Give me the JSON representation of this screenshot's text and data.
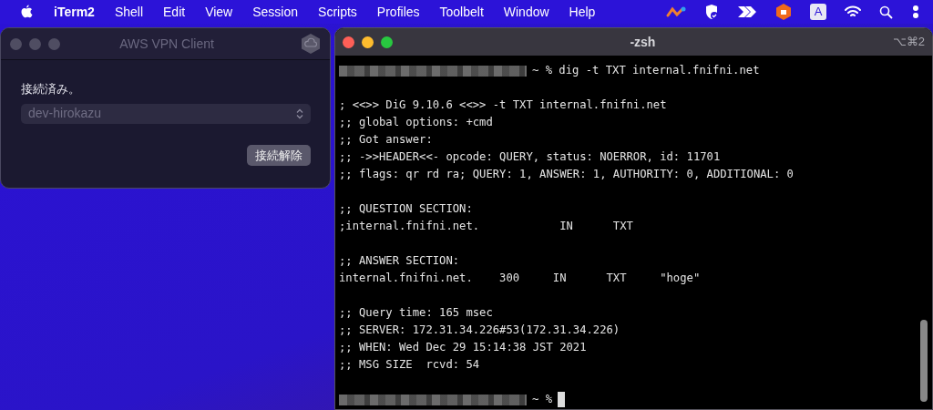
{
  "menubar": {
    "app": "iTerm2",
    "items": [
      "Shell",
      "Edit",
      "View",
      "Session",
      "Scripts",
      "Profiles",
      "Toolbelt",
      "Window",
      "Help"
    ],
    "input_source": "A"
  },
  "vpn_window": {
    "title": "AWS VPN Client",
    "status": "接続済み。",
    "profile": "dev-hirokazu",
    "button": "接続解除"
  },
  "terminal": {
    "title": "-zsh",
    "shortcut": "⌥⌘2",
    "lines": [
      {
        "kind": "prompt",
        "text": "~ % dig -t TXT internal.fnifni.net",
        "cursor": false
      },
      {
        "kind": "blank"
      },
      {
        "kind": "output",
        "text": "; <<>> DiG 9.10.6 <<>> -t TXT internal.fnifni.net"
      },
      {
        "kind": "output",
        "text": ";; global options: +cmd"
      },
      {
        "kind": "output",
        "text": ";; Got answer:"
      },
      {
        "kind": "output",
        "text": ";; ->>HEADER<<- opcode: QUERY, status: NOERROR, id: 11701"
      },
      {
        "kind": "output",
        "text": ";; flags: qr rd ra; QUERY: 1, ANSWER: 1, AUTHORITY: 0, ADDITIONAL: 0"
      },
      {
        "kind": "blank"
      },
      {
        "kind": "output",
        "text": ";; QUESTION SECTION:"
      },
      {
        "kind": "output",
        "text": ";internal.fnifni.net.            IN      TXT"
      },
      {
        "kind": "blank"
      },
      {
        "kind": "output",
        "text": ";; ANSWER SECTION:"
      },
      {
        "kind": "output",
        "text": "internal.fnifni.net.    300     IN      TXT     \"hoge\""
      },
      {
        "kind": "blank"
      },
      {
        "kind": "output",
        "text": ";; Query time: 165 msec"
      },
      {
        "kind": "output",
        "text": ";; SERVER: 172.31.34.226#53(172.31.34.226)"
      },
      {
        "kind": "output",
        "text": ";; WHEN: Wed Dec 29 15:14:38 JST 2021"
      },
      {
        "kind": "output",
        "text": ";; MSG SIZE  rcvd: 54"
      },
      {
        "kind": "blank"
      },
      {
        "kind": "prompt",
        "text": "~ %",
        "cursor": true
      }
    ]
  }
}
